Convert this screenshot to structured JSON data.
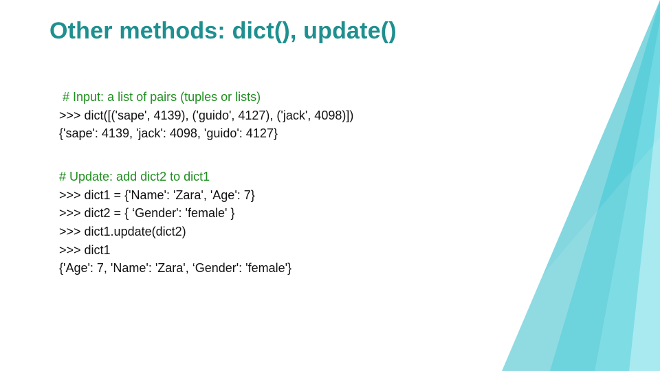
{
  "title": "Other methods: dict(), update()",
  "block1": {
    "l1_indent": " ",
    "l1": "# Input: a list of pairs (tuples or lists)",
    "l2": ">>> dict([('sape', 4139), ('guido', 4127), ('jack', 4098)])",
    "l3": "{'sape': 4139, 'jack': 4098, 'guido': 4127}"
  },
  "block2": {
    "l1": "# Update: add dict2 to dict1",
    "l2": ">>> dict1 = {'Name': 'Zara', 'Age': 7}",
    "l3": ">>> dict2 = { ‘Gender': 'female' }",
    "l4": ">>> dict1.update(dict2)",
    "l5": ">>> dict1",
    "l6": "{'Age': 7, 'Name': 'Zara', ‘Gender': 'female'}"
  }
}
